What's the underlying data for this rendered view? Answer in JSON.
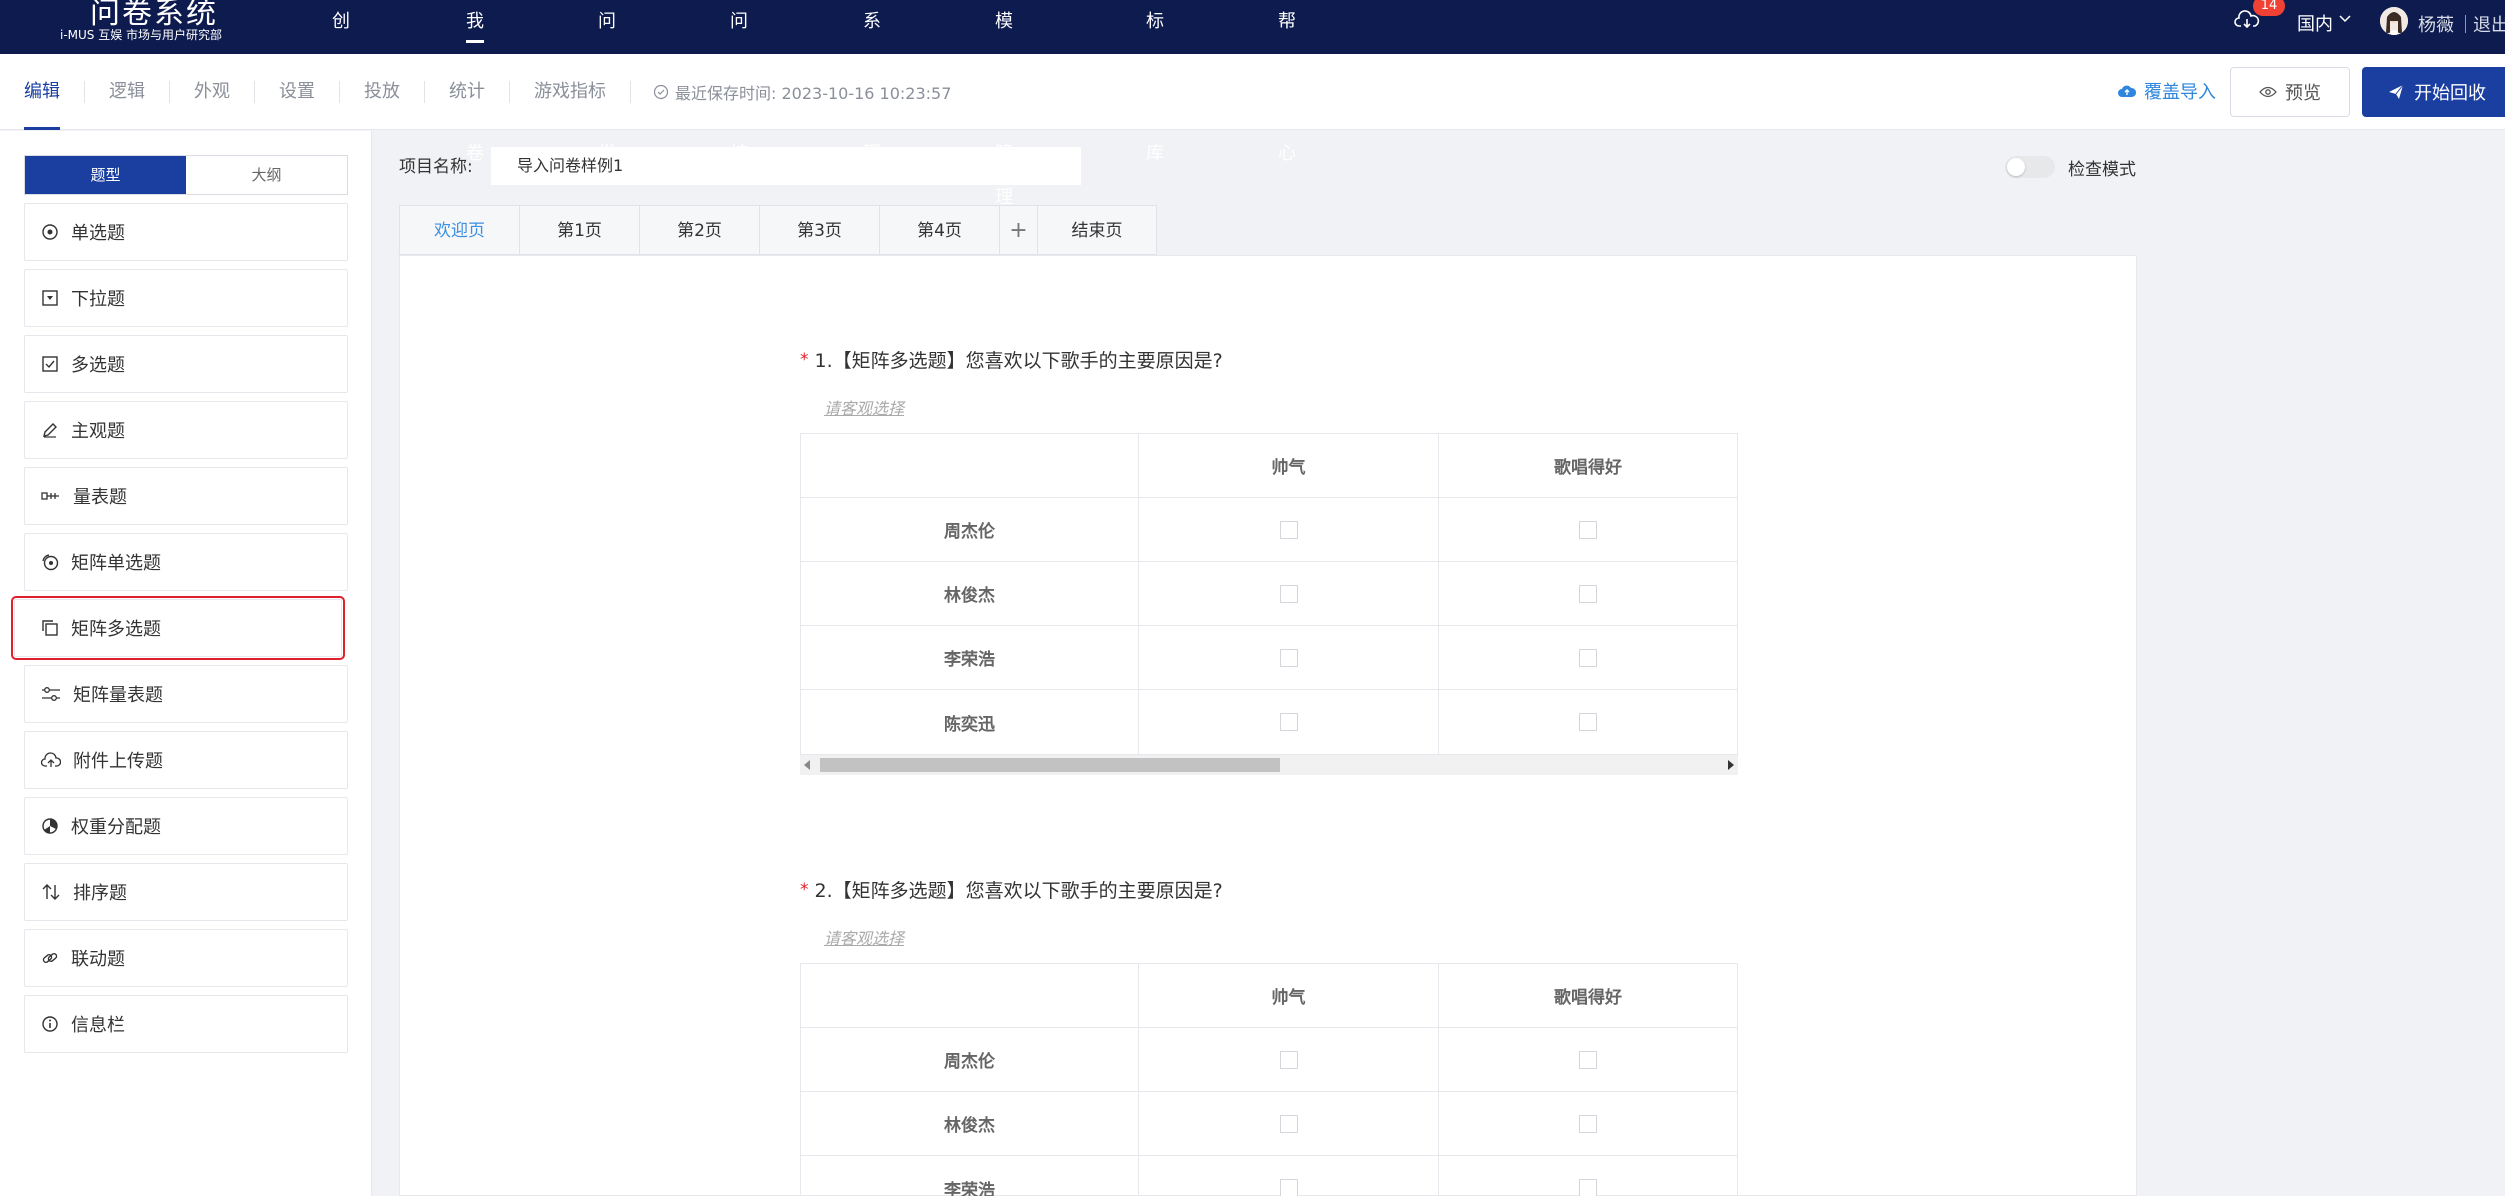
{
  "app": {
    "logo_name": "问卷系统",
    "logo_brand": "i-MUS 互娱 市场与用户研究部"
  },
  "nav": {
    "items": [
      {
        "label": "创建问卷"
      },
      {
        "label": "我的问卷"
      },
      {
        "label": "问卷分发"
      },
      {
        "label": "问卷审核"
      },
      {
        "label": "系统管理"
      },
      {
        "label": "模板库管理"
      },
      {
        "label": "标准题库"
      },
      {
        "label": "帮助中心"
      }
    ],
    "active_index": 1
  },
  "topright": {
    "notification_count": "14",
    "region": "国内",
    "user": "杨薇",
    "logout": "退出"
  },
  "subbar": {
    "tabs": [
      {
        "label": "编辑"
      },
      {
        "label": "逻辑"
      },
      {
        "label": "外观"
      },
      {
        "label": "设置"
      },
      {
        "label": "投放"
      },
      {
        "label": "统计"
      },
      {
        "label": "游戏指标"
      }
    ],
    "save_time": "最近保存时间: 2023-10-16 10:23:57",
    "import_label": "覆盖导入",
    "preview_label": "预览",
    "start_label": "开始回收"
  },
  "leftpanel": {
    "tabs": [
      {
        "label": "题型"
      },
      {
        "label": "大纲"
      }
    ],
    "types": [
      {
        "label": "单选题",
        "icon": "radio-icon"
      },
      {
        "label": "下拉题",
        "icon": "dropdown-icon"
      },
      {
        "label": "多选题",
        "icon": "checkbox-icon"
      },
      {
        "label": "主观题",
        "icon": "pencil-icon"
      },
      {
        "label": "量表题",
        "icon": "scale-icon"
      },
      {
        "label": "矩阵单选题",
        "icon": "matrix-radio-icon"
      },
      {
        "label": "矩阵多选题",
        "icon": "matrix-checkbox-icon"
      },
      {
        "label": "矩阵量表题",
        "icon": "sliders-icon"
      },
      {
        "label": "附件上传题",
        "icon": "upload-icon"
      },
      {
        "label": "权重分配题",
        "icon": "pie-icon"
      },
      {
        "label": "排序题",
        "icon": "sort-icon"
      },
      {
        "label": "联动题",
        "icon": "link-icon"
      },
      {
        "label": "信息栏",
        "icon": "info-icon"
      }
    ],
    "highlight_index": 6
  },
  "main": {
    "project_label": "项目名称:",
    "project_name": "导入问卷样例1",
    "check_mode_label": "检查模式",
    "page_tabs": [
      {
        "label": "欢迎页"
      },
      {
        "label": "第1页"
      },
      {
        "label": "第2页"
      },
      {
        "label": "第3页"
      },
      {
        "label": "第4页"
      },
      {
        "label": "+"
      },
      {
        "label": "结束页"
      }
    ],
    "questions": [
      {
        "title": "1.【矩阵多选题】您喜欢以下歌手的主要原因是?",
        "subtitle": "请客观选择",
        "columns": [
          "帅气",
          "歌唱得好"
        ],
        "rows": [
          "周杰伦",
          "林俊杰",
          "李荣浩",
          "陈奕迅"
        ]
      },
      {
        "title": "2.【矩阵多选题】您喜欢以下歌手的主要原因是?",
        "subtitle": "请客观选择",
        "columns": [
          "帅气",
          "歌唱得好"
        ],
        "rows": [
          "周杰伦",
          "林俊杰",
          "李荣浩"
        ]
      }
    ]
  }
}
